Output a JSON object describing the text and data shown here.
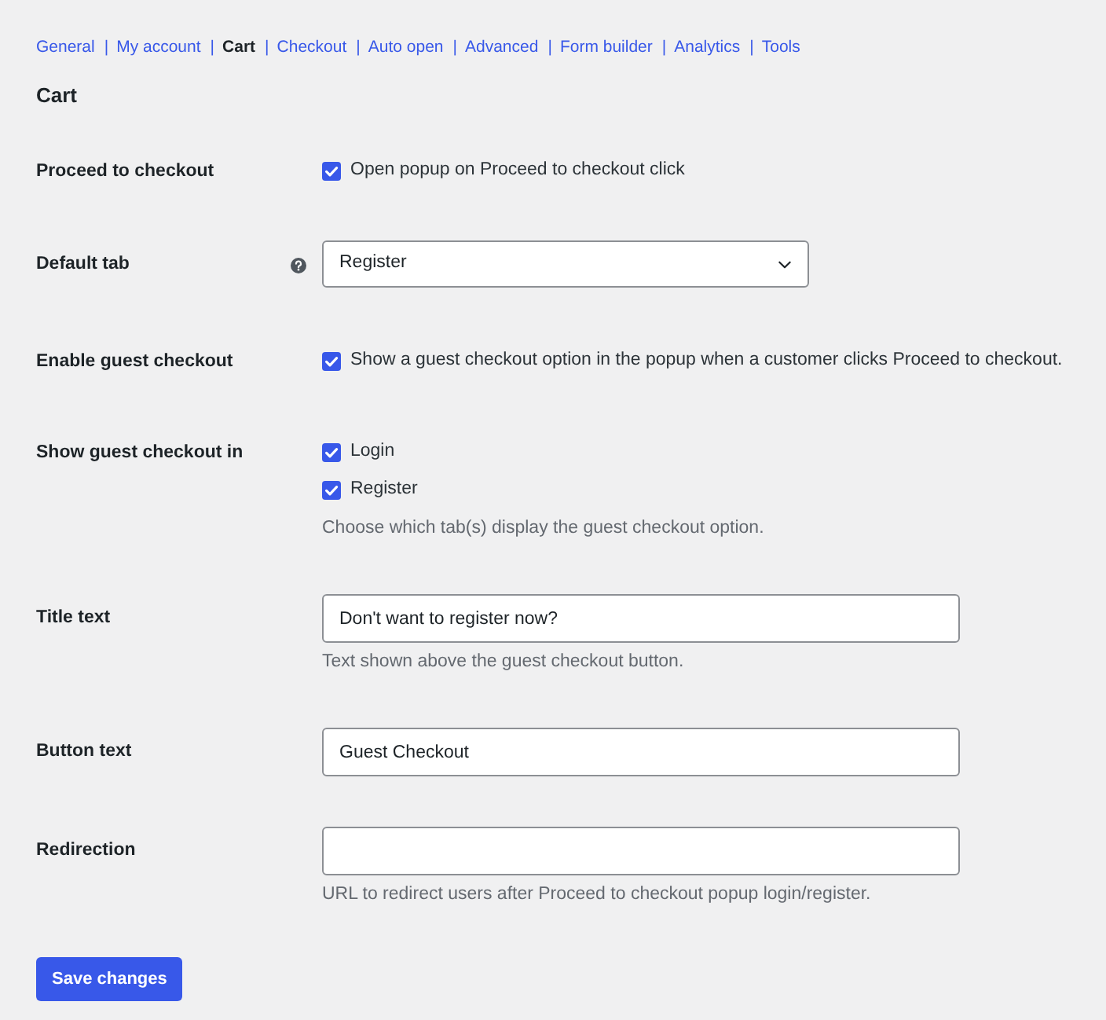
{
  "nav": {
    "separator": "|",
    "tabs": [
      {
        "label": "General",
        "selected": false
      },
      {
        "label": "My account",
        "selected": false
      },
      {
        "label": "Cart",
        "selected": true
      },
      {
        "label": "Checkout",
        "selected": false
      },
      {
        "label": "Auto open",
        "selected": false
      },
      {
        "label": "Advanced",
        "selected": false
      },
      {
        "label": "Form builder",
        "selected": false
      },
      {
        "label": "Analytics",
        "selected": false
      },
      {
        "label": "Tools",
        "selected": false
      }
    ]
  },
  "heading": "Cart",
  "fields": [
    {
      "kind": "checkboxes",
      "label": "Proceed to checkout",
      "help": false,
      "options": [
        {
          "label": "Open popup on Proceed to checkout click",
          "checked": true
        }
      ]
    },
    {
      "kind": "select",
      "label": "Default tab",
      "help": true,
      "value": "Register"
    },
    {
      "kind": "checkboxes",
      "label": "Enable guest checkout",
      "help": false,
      "options": [
        {
          "label": "Show a guest checkout option in the popup when a customer clicks Proceed to checkout.",
          "checked": true
        }
      ]
    },
    {
      "kind": "checkboxes",
      "label": "Show guest checkout in",
      "help": false,
      "options": [
        {
          "label": "Login",
          "checked": true
        },
        {
          "label": "Register",
          "checked": true
        }
      ],
      "description": "Choose which tab(s) display the guest checkout option."
    },
    {
      "kind": "text",
      "label": "Title text",
      "help": false,
      "value": "Don't want to register now?",
      "description": "Text shown above the guest checkout button."
    },
    {
      "kind": "text",
      "label": "Button text",
      "help": false,
      "value": "Guest Checkout"
    },
    {
      "kind": "text",
      "label": "Redirection",
      "help": false,
      "description": "URL to redirect users after Proceed to checkout popup login/register."
    }
  ],
  "save_button": "Save changes"
}
